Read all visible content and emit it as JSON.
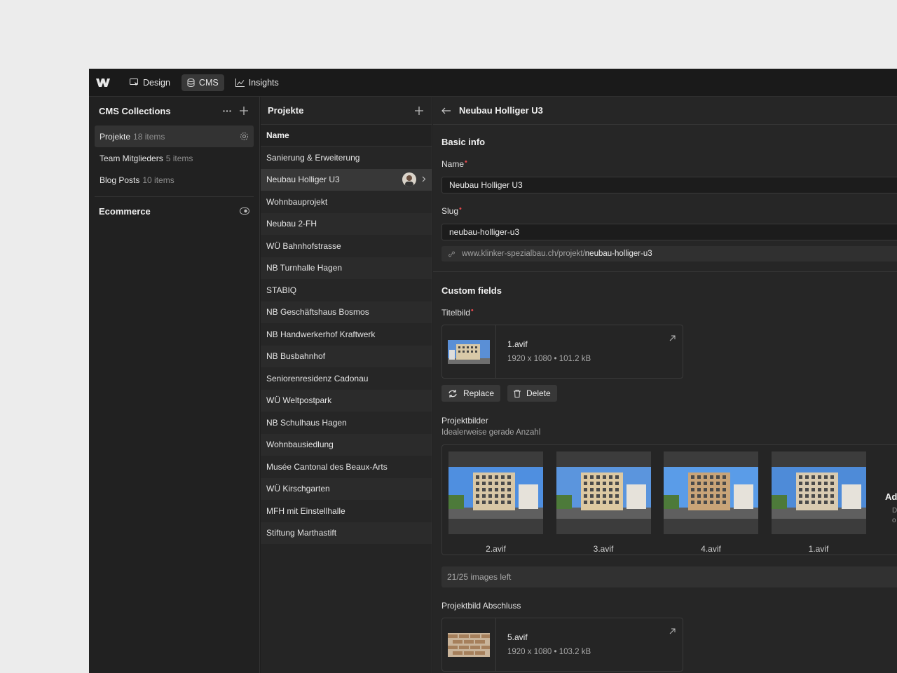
{
  "topbar": {
    "tabs": [
      {
        "label": "Design",
        "icon": "design-icon"
      },
      {
        "label": "CMS",
        "icon": "database-icon"
      },
      {
        "label": "Insights",
        "icon": "chart-icon"
      }
    ]
  },
  "collections": {
    "title": "CMS Collections",
    "items": [
      {
        "name": "Projekte",
        "count": "18 items"
      },
      {
        "name": "Team Mitglieders",
        "count": "5 items"
      },
      {
        "name": "Blog Posts",
        "count": "10 items"
      }
    ],
    "ecommerce": "Ecommerce"
  },
  "list": {
    "title": "Projekte",
    "column_header": "Name",
    "rows": [
      "Sanierung & Erweiterung",
      "Neubau Holliger U3",
      "Wohnbauprojekt",
      "Neubau 2-FH",
      "WÜ Bahnhofstrasse",
      "NB Turnhalle Hagen",
      "STABIQ",
      "NB Geschäftshaus Bosmos",
      "NB Handwerkerhof Kraftwerk",
      "NB Busbahnhof",
      "Seniorenresidenz Cadonau",
      "WÜ Weltpostpark",
      "NB Schulhaus Hagen",
      "Wohnbausiedlung",
      "Musée Cantonal des Beaux-Arts",
      "WÜ Kirschgarten",
      "MFH mit Einstellhalle",
      "Stiftung Marthastift"
    ]
  },
  "editor": {
    "title": "Neubau Holliger U3",
    "basic_info": "Basic info",
    "name_label": "Name",
    "name_value": "Neubau Holliger U3",
    "slug_label": "Slug",
    "slug_value": "neubau-holliger-u3",
    "url_prefix": "www.klinker-spezialbau.ch/projekt/",
    "url_slug": "neubau-holliger-u3",
    "custom_fields": "Custom fields",
    "titelbild_label": "Titelbild",
    "titelbild": {
      "file": "1.avif",
      "info": "1920 x 1080 • 101.2 kB"
    },
    "replace_label": "Replace",
    "delete_label": "Delete",
    "projektbilder_label": "Projektbilder",
    "projektbilder_hint": "Idealerweise gerade Anzahl",
    "gallery": [
      "2.avif",
      "3.avif",
      "4.avif",
      "1.avif"
    ],
    "add_title": "Ad",
    "add_sub": "D\no",
    "images_left": "21/25 images left",
    "abschluss_label": "Projektbild Abschluss",
    "abschluss": {
      "file": "5.avif",
      "info": "1920 x 1080 • 103.2 kB"
    }
  }
}
